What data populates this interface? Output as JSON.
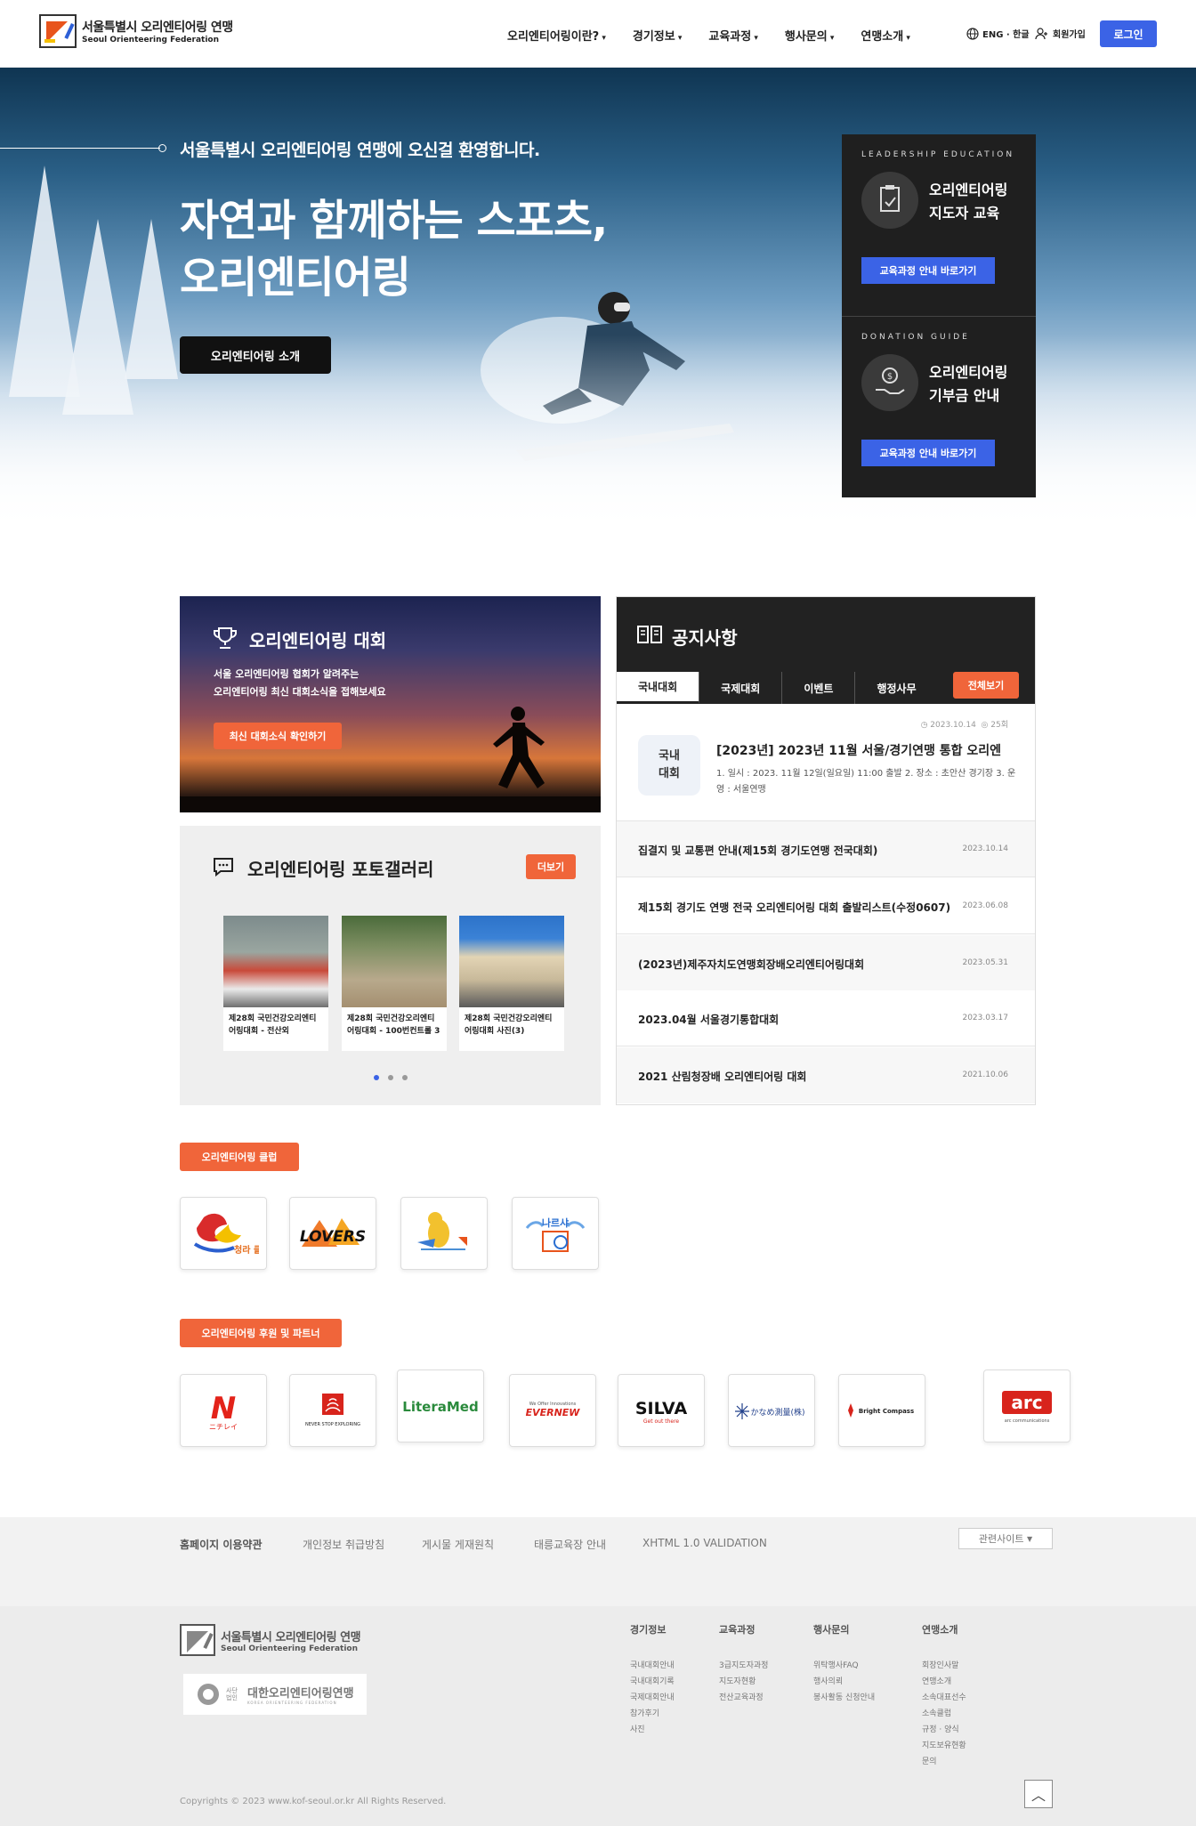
{
  "header": {
    "logo_ko": "서울특별시 오리엔티어링 연맹",
    "logo_en": "Seoul Orienteering Federation",
    "nav": [
      "오리엔티어링이란?",
      "경기정보",
      "교육과정",
      "행사문의",
      "연맹소개"
    ],
    "lang": "ENG · 한글",
    "join": "회원가입",
    "login": "로그인"
  },
  "hero": {
    "subtitle": "서울특별시 오리엔티어링 연맹에 오신걸 환영합니다.",
    "title_line1": "자연과 함께하는 스포츠,",
    "title_line2": "오리엔티어링",
    "button": "오리엔티어링 소개"
  },
  "side_panel": [
    {
      "caption": "LEADERSHIP EDUCATION",
      "title_line1": "오리엔티어링",
      "title_line2": "지도자 교육",
      "button": "교육과정 안내 바로가기",
      "icon": "clipboard-icon"
    },
    {
      "caption": "DONATION GUIDE",
      "title_line1": "오리엔티어링",
      "title_line2": "기부금 안내",
      "button": "교육과정 안내 바로가기",
      "icon": "donation-icon"
    }
  ],
  "competition": {
    "title": "오리엔티어링 대회",
    "desc_line1": "서울 오리엔티어링 협회가 알려주는",
    "desc_line2": "오리엔티어링 최신 대회소식을 접해보세요",
    "button": "최신 대회소식 확인하기"
  },
  "gallery": {
    "title": "오리엔티어링 포토갤러리",
    "more": "더보기",
    "items": [
      {
        "line1": "제28회 국민건강오리엔티",
        "line2": "어링대회 - 전산외"
      },
      {
        "line1": "제28회 국민건강오리엔티",
        "line2": "어링대회 - 100번컨트롤 3"
      },
      {
        "line1": "제28회 국민건강오리엔티",
        "line2": "어링대회 사진(3)"
      }
    ]
  },
  "notice": {
    "title": "공지사항",
    "tabs": [
      "국내대회",
      "국제대회",
      "이벤트",
      "행정사무"
    ],
    "all": "전체보기",
    "featured": {
      "date": "2023.10.14",
      "views": "25회",
      "badge_line1": "국내",
      "badge_line2": "대회",
      "title": "[2023년] 2023년 11월 서울/경기연맹 통합 오리엔",
      "desc": "1. 일시 : 2023. 11월 12일(일요일) 11:00 출발 2. 장소 : 초안산 경기장 3. 운영 : 서울연맹"
    },
    "rows": [
      {
        "title": "집결지 및 교통편 안내(제15회 경기도연맹 전국대회)",
        "date": "2023.10.14"
      },
      {
        "title": "제15회 경기도 연맹 전국 오리엔티어링 대회 출발리스트(수정0607)",
        "date": "2023.06.08"
      },
      {
        "title": "(2023년)제주자치도연맹회장배오리엔티어링대회",
        "date": "2023.05.31"
      },
      {
        "title": "2023.04월 서울경기통합대회",
        "date": "2023.03.17"
      },
      {
        "title": "2021 산림청장배 오리엔티어링 대회",
        "date": "2021.10.06"
      }
    ]
  },
  "clubs": {
    "label": "오리엔티어링 클럽",
    "logos": [
      "청라 클럽",
      "LOVERS",
      "club-3",
      "나르샤"
    ]
  },
  "partners": {
    "label": "오리엔티어링 후원 및 파트너",
    "logos": [
      "N",
      "THE NORTH FACE",
      "LiteraMed",
      "EVERNEW",
      "SILVA",
      "かなめ測量(株)",
      "Bright Compass",
      "arc"
    ],
    "logo_subs": [
      "ニチレイ",
      "NEVER STOP EXPLORING",
      "",
      "We Offer Innovations",
      "Get out there",
      "",
      "",
      "arc communications"
    ]
  },
  "footer": {
    "links": [
      "홈페이지 이용약관",
      "개인정보 취급방침",
      "게시물 게재원칙",
      "태릉교육장 안내",
      "XHTML 1.0 VALIDATION"
    ],
    "related": "관련사이트",
    "logo_ko": "서울특별시 오리엔티어링 연맹",
    "logo_en": "Seoul Orienteering Federation",
    "kof_ko": "대한오리엔티어링연맹",
    "kof_small": "사단 법인",
    "kof_en": "KOREA ORIENTEERING FEDERATION",
    "columns": [
      {
        "head": "경기정보",
        "items": [
          "국내대회안내",
          "국내대회기록",
          "국제대회안내",
          "참가후기",
          "사진"
        ]
      },
      {
        "head": "교육과정",
        "items": [
          "3급지도자과정",
          "지도자현황",
          "전산교육과정"
        ]
      },
      {
        "head": "행사문의",
        "items": [
          "위탁행사FAQ",
          "행사의뢰",
          "봉사활동 신청안내"
        ]
      },
      {
        "head": "연맹소개",
        "items": [
          "회장인사말",
          "연맹소개",
          "소속대표선수",
          "소속클럽",
          "규정 · 양식",
          "지도보유현황",
          "문의"
        ]
      }
    ],
    "copyright": "Copyrights © 2023 www.kof-seoul.or.kr All Rights Reserved."
  }
}
